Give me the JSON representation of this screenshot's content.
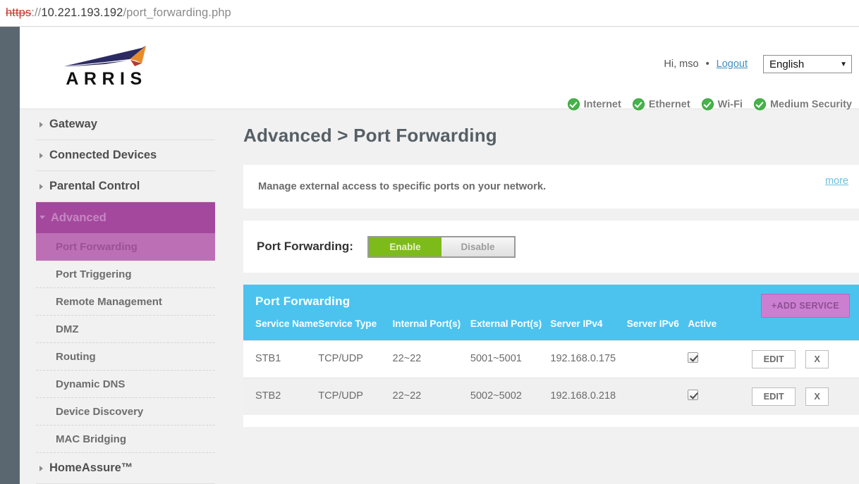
{
  "browser": {
    "url_scheme": "https",
    "url_separator": "://",
    "url_host": "10.221.193.192",
    "url_path": "/port_forwarding.php"
  },
  "header": {
    "logo_text": "ARRIS",
    "greeting": "Hi, mso",
    "separator": "•",
    "logout_label": "Logout",
    "language_selected": "English",
    "language_caret": "▼",
    "status_items": [
      {
        "icon": "check-circle-icon",
        "label": "Internet"
      },
      {
        "icon": "check-circle-icon",
        "label": "Ethernet"
      },
      {
        "icon": "check-circle-icon",
        "label": "Wi-Fi"
      },
      {
        "icon": "check-circle-icon",
        "label": "Medium Security"
      }
    ],
    "status_color": "#46b34a"
  },
  "sidebar": {
    "top_items": [
      {
        "label": "Gateway",
        "expanded": false
      },
      {
        "label": "Connected Devices",
        "expanded": false
      },
      {
        "label": "Parental Control",
        "expanded": false
      },
      {
        "label": "Advanced",
        "expanded": true
      },
      {
        "label": "HomeAssure™",
        "expanded": false
      }
    ],
    "advanced_sub_items": [
      {
        "label": "Port Forwarding",
        "active": true
      },
      {
        "label": "Port Triggering",
        "active": false
      },
      {
        "label": "Remote Management",
        "active": false
      },
      {
        "label": "DMZ",
        "active": false
      },
      {
        "label": "Routing",
        "active": false
      },
      {
        "label": "Dynamic DNS",
        "active": false
      },
      {
        "label": "Device Discovery",
        "active": false
      },
      {
        "label": "MAC Bridging",
        "active": false
      }
    ],
    "active_color": "#a4489e",
    "active_sub_color": "#bd6fb6"
  },
  "main": {
    "page_title": "Advanced > Port Forwarding",
    "description": "Manage external access to specific ports on your network.",
    "more_label": "more",
    "toggle_label": "Port Forwarding:",
    "toggle_enable": "Enable",
    "toggle_disable": "Disable",
    "toggle_state": "Enable",
    "enable_color": "#7dbb1b"
  },
  "table": {
    "title": "Port Forwarding",
    "add_button": "+ADD SERVICE",
    "add_button_color": "#cc7fd1",
    "header_color": "#4cc3ef",
    "columns": [
      "Service Name",
      "Service Type",
      "Internal Port(s)",
      "External Port(s)",
      "Server IPv4",
      "Server IPv6",
      "Active",
      ""
    ],
    "edit_label": "EDIT",
    "delete_label": "X",
    "rows": [
      {
        "service_name": "STB1",
        "service_type": "TCP/UDP",
        "internal_ports": "22~22",
        "external_ports": "5001~5001",
        "server_ipv4": "192.168.0.175",
        "server_ipv6": "",
        "active": true
      },
      {
        "service_name": "STB2",
        "service_type": "TCP/UDP",
        "internal_ports": "22~22",
        "external_ports": "5002~5002",
        "server_ipv4": "192.168.0.218",
        "server_ipv6": "",
        "active": true
      }
    ]
  }
}
